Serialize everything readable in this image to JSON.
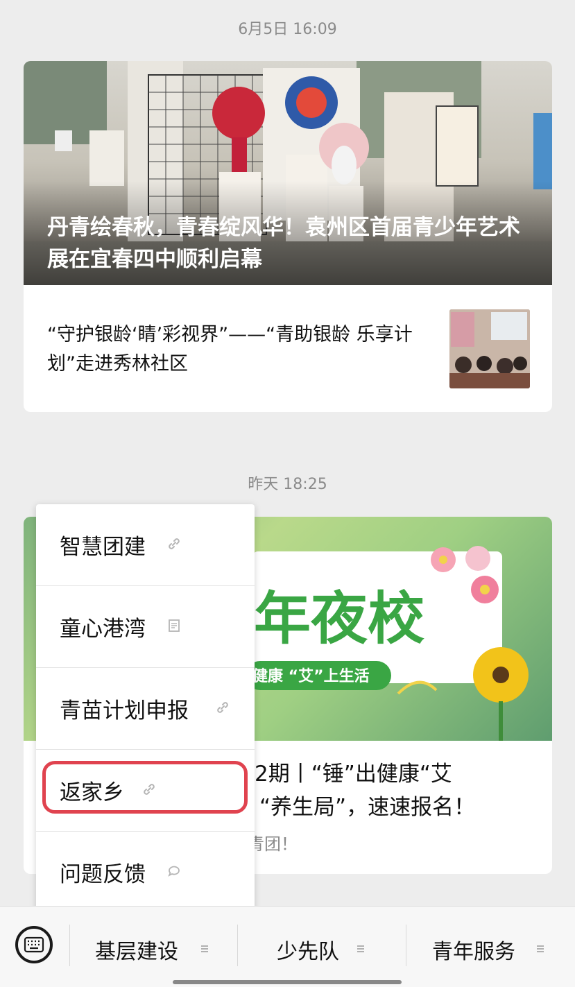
{
  "timestamps": {
    "first": "6月5日 16:09",
    "second": "昨天 18:25"
  },
  "article1": {
    "hero_title": "丹青绘春秋，青春绽风华！袁州区首届青少年艺术展在宜春四中顺利启幕",
    "sub_title": "“守护银龄‘睛’彩视界”——“青助银龄 乐享计划”走进秀林社区"
  },
  "article2": {
    "banner_text": "年夜校",
    "banner_sub": "健康 “艾”上生活",
    "title_line1": "2期丨“锤”出健康“艾",
    "title_line2": "“养生局”，速速报名！",
    "desc": "青团！"
  },
  "menu": {
    "items": [
      {
        "label": "智慧团建",
        "icon": "link-icon"
      },
      {
        "label": "童心港湾",
        "icon": "article-icon"
      },
      {
        "label": "青苗计划申报",
        "icon": "link-icon"
      },
      {
        "label": "返家乡",
        "icon": "link-icon"
      },
      {
        "label": "问题反馈",
        "icon": "chat-icon"
      }
    ]
  },
  "bottom_tabs": [
    {
      "label": "基层建设"
    },
    {
      "label": "少先队"
    },
    {
      "label": "青年服务"
    }
  ],
  "colors": {
    "highlight": "#e0434f",
    "banner_green": "#3aa644"
  }
}
